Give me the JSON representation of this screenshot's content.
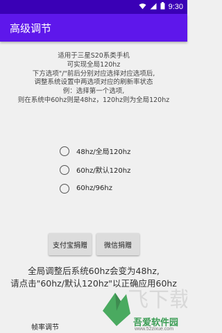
{
  "status_bar": {
    "time": "9:30",
    "icons": [
      "wifi-icon",
      "signal-icon",
      "battery-icon"
    ]
  },
  "app_bar": {
    "title": "高级调节"
  },
  "description": {
    "lines": [
      "适用于三星S20系类手机",
      "可实现全局120hz",
      "下方选项\"/\"前后分别对应选择对应选项后,",
      "调整系统设置中两选项对应的刷新率状态",
      "例：选择第一个选项,",
      "则在系统中60hz则是48hz，120hz则为全局120hz"
    ]
  },
  "options": [
    {
      "label": "48hz/全局120hz",
      "checked": false
    },
    {
      "label": "60hz/默认120hz",
      "checked": false
    },
    {
      "label": "60hz/96hz",
      "checked": false
    }
  ],
  "buttons": {
    "alipay_label": "支付宝捐赠",
    "wechat_label": "微信捐赠"
  },
  "notice": {
    "lines": [
      "全局调整后系统60hz会变为48hz,",
      "请点击\"60hz/默认120hz\"以正确应用60hz"
    ]
  },
  "bottom_tab": {
    "label": "帧率调节"
  },
  "watermark": {
    "brand": "吾爱软件园",
    "url": "www.52zixue.com"
  },
  "colors": {
    "status_bar": "#3a00b6",
    "app_bar": "#5e17eb",
    "background": "#f0f0f0",
    "watermark_green": "#1d8f3a"
  }
}
